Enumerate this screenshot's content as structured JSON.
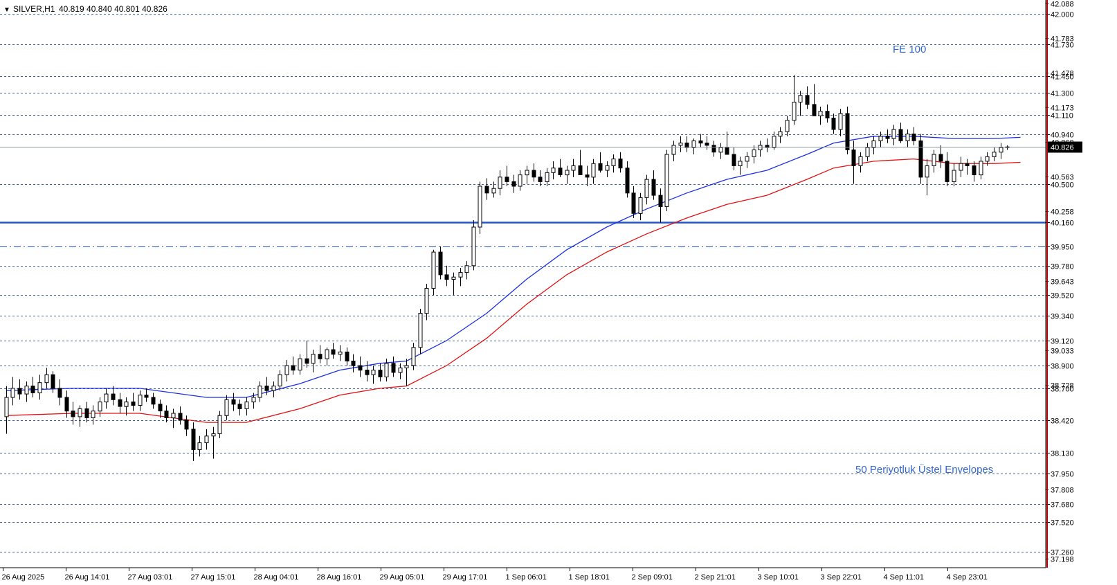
{
  "header": {
    "symbol": "SILVER,H1",
    "ohlc": "40.819 40.840 40.801 40.826"
  },
  "annotations": {
    "fe": "FE 100",
    "envelopes": "50 Periyotluk Üstel Envelopes"
  },
  "colors": {
    "background": "#ffffff",
    "grid_line": "#3a5fa0",
    "support_line": "#2255cc",
    "upper_envelope": "#1a2fe0",
    "lower_envelope": "#e01010",
    "candle": "#000000",
    "label_text": "#3366cc",
    "axis_border": "#b00000"
  },
  "chart_data": {
    "type": "candlestick",
    "title": "SILVER,H1",
    "ylim": [
      37.12,
      42.12
    ],
    "current_price": 40.826,
    "price_scale_ticks": [
      "42.088",
      "41.783",
      "41.478",
      "41.173",
      "40.868",
      "40.563",
      "40.258",
      "39.643",
      "39.033",
      "38.728",
      "37.808",
      "37.198"
    ],
    "level_lines": [
      {
        "value": 42.0,
        "label": "42.000",
        "style": "dashed"
      },
      {
        "value": 41.73,
        "label": "41.730",
        "style": "dashed"
      },
      {
        "value": 41.45,
        "label": "41.450",
        "style": "dashed"
      },
      {
        "value": 41.3,
        "label": "41.300",
        "style": "dashed"
      },
      {
        "value": 41.11,
        "label": "41.110",
        "style": "dashed"
      },
      {
        "value": 40.94,
        "label": "40.940",
        "style": "dashed"
      },
      {
        "value": 40.5,
        "label": "40.500",
        "style": "dashed"
      },
      {
        "value": 40.16,
        "label": "40.160",
        "style": "solid"
      },
      {
        "value": 39.95,
        "label": "39.950",
        "style": "dashdot"
      },
      {
        "value": 39.78,
        "label": "39.780",
        "style": "dashed"
      },
      {
        "value": 39.52,
        "label": "39.520",
        "style": "dashed"
      },
      {
        "value": 39.34,
        "label": "39.340",
        "style": "dashed"
      },
      {
        "value": 39.12,
        "label": "39.120",
        "style": "dashed"
      },
      {
        "value": 38.9,
        "label": "38.900",
        "style": "dashed"
      },
      {
        "value": 38.7,
        "label": "38.700",
        "style": "dashed"
      },
      {
        "value": 38.42,
        "label": "38.420",
        "style": "dashed"
      },
      {
        "value": 38.13,
        "label": "38.130",
        "style": "dashed"
      },
      {
        "value": 37.95,
        "label": "37.950",
        "style": "dashed"
      },
      {
        "value": 37.68,
        "label": "37.680",
        "style": "dashed"
      },
      {
        "value": 37.52,
        "label": "37.520",
        "style": "dashed"
      },
      {
        "value": 37.26,
        "label": "37.260",
        "style": "dashed"
      }
    ],
    "time_labels": [
      "26 Aug 2025",
      "26 Aug 14:01",
      "27 Aug 03:01",
      "27 Aug 15:01",
      "28 Aug 04:01",
      "28 Aug 16:01",
      "29 Aug 05:01",
      "29 Aug 17:01",
      "1 Sep 06:01",
      "1 Sep 18:01",
      "2 Sep 09:01",
      "2 Sep 21:01",
      "3 Sep 10:01",
      "3 Sep 22:01",
      "4 Sep 11:01",
      "4 Sep 23:01"
    ],
    "ohlc": [
      [
        38.45,
        38.72,
        38.3,
        38.62
      ],
      [
        38.62,
        38.8,
        38.55,
        38.7
      ],
      [
        38.7,
        38.78,
        38.6,
        38.65
      ],
      [
        38.65,
        38.76,
        38.58,
        38.72
      ],
      [
        38.72,
        38.8,
        38.62,
        38.66
      ],
      [
        38.66,
        38.82,
        38.6,
        38.75
      ],
      [
        38.75,
        38.88,
        38.7,
        38.82
      ],
      [
        38.82,
        38.85,
        38.66,
        38.7
      ],
      [
        38.7,
        38.78,
        38.55,
        38.62
      ],
      [
        38.62,
        38.68,
        38.44,
        38.5
      ],
      [
        38.5,
        38.58,
        38.38,
        38.45
      ],
      [
        38.45,
        38.55,
        38.36,
        38.52
      ],
      [
        38.52,
        38.58,
        38.4,
        38.44
      ],
      [
        38.44,
        38.55,
        38.38,
        38.5
      ],
      [
        38.5,
        38.62,
        38.45,
        38.58
      ],
      [
        38.58,
        38.7,
        38.52,
        38.65
      ],
      [
        38.65,
        38.72,
        38.55,
        38.6
      ],
      [
        38.6,
        38.66,
        38.48,
        38.54
      ],
      [
        38.54,
        38.62,
        38.46,
        38.58
      ],
      [
        38.58,
        38.66,
        38.5,
        38.55
      ],
      [
        38.55,
        38.68,
        38.5,
        38.64
      ],
      [
        38.64,
        38.7,
        38.58,
        38.62
      ],
      [
        38.62,
        38.66,
        38.52,
        38.56
      ],
      [
        38.56,
        38.6,
        38.44,
        38.5
      ],
      [
        38.5,
        38.55,
        38.4,
        38.44
      ],
      [
        38.44,
        38.52,
        38.35,
        38.48
      ],
      [
        38.48,
        38.54,
        38.38,
        38.42
      ],
      [
        38.42,
        38.46,
        38.28,
        38.34
      ],
      [
        38.34,
        38.4,
        38.06,
        38.16
      ],
      [
        38.16,
        38.28,
        38.1,
        38.22
      ],
      [
        38.22,
        38.34,
        38.16,
        38.28
      ],
      [
        38.28,
        38.36,
        38.08,
        38.3
      ],
      [
        38.3,
        38.5,
        38.26,
        38.46
      ],
      [
        38.46,
        38.64,
        38.42,
        38.6
      ],
      [
        38.6,
        38.66,
        38.5,
        38.56
      ],
      [
        38.56,
        38.6,
        38.46,
        38.52
      ],
      [
        38.52,
        38.62,
        38.46,
        38.58
      ],
      [
        38.58,
        38.66,
        38.52,
        38.62
      ],
      [
        38.62,
        38.76,
        38.58,
        38.72
      ],
      [
        38.72,
        38.8,
        38.64,
        38.68
      ],
      [
        38.68,
        38.76,
        38.62,
        38.72
      ],
      [
        38.72,
        38.86,
        38.68,
        38.82
      ],
      [
        38.82,
        38.95,
        38.76,
        38.9
      ],
      [
        38.9,
        38.98,
        38.82,
        38.86
      ],
      [
        38.86,
        39.0,
        38.82,
        38.96
      ],
      [
        38.96,
        39.12,
        38.88,
        38.92
      ],
      [
        38.92,
        39.04,
        38.84,
        39.0
      ],
      [
        39.0,
        39.08,
        38.92,
        38.96
      ],
      [
        38.96,
        39.06,
        38.9,
        39.04
      ],
      [
        39.04,
        39.1,
        38.96,
        39.0
      ],
      [
        39.0,
        39.08,
        38.94,
        39.02
      ],
      [
        39.02,
        39.06,
        38.9,
        38.94
      ],
      [
        38.94,
        39.0,
        38.84,
        38.9
      ],
      [
        38.9,
        38.98,
        38.8,
        38.86
      ],
      [
        38.86,
        38.94,
        38.76,
        38.82
      ],
      [
        38.82,
        38.9,
        38.74,
        38.86
      ],
      [
        38.86,
        38.92,
        38.76,
        38.8
      ],
      [
        38.8,
        38.96,
        38.76,
        38.92
      ],
      [
        38.92,
        38.98,
        38.8,
        38.84
      ],
      [
        38.84,
        38.92,
        38.78,
        38.88
      ],
      [
        38.88,
        38.96,
        38.72,
        38.9
      ],
      [
        38.9,
        39.1,
        38.86,
        39.06
      ],
      [
        39.06,
        39.4,
        39.0,
        39.36
      ],
      [
        39.36,
        39.62,
        39.3,
        39.58
      ],
      [
        39.58,
        39.92,
        39.52,
        39.9
      ],
      [
        39.9,
        39.95,
        39.66,
        39.7
      ],
      [
        39.7,
        39.78,
        39.6,
        39.66
      ],
      [
        39.66,
        39.72,
        39.52,
        39.68
      ],
      [
        39.68,
        39.76,
        39.6,
        39.72
      ],
      [
        39.72,
        39.82,
        39.66,
        39.78
      ],
      [
        39.78,
        40.18,
        39.74,
        40.12
      ],
      [
        40.12,
        40.52,
        40.06,
        40.48
      ],
      [
        40.48,
        40.55,
        40.36,
        40.42
      ],
      [
        40.42,
        40.52,
        40.38,
        40.46
      ],
      [
        40.46,
        40.62,
        40.4,
        40.56
      ],
      [
        40.56,
        40.66,
        40.48,
        40.52
      ],
      [
        40.52,
        40.58,
        40.42,
        40.48
      ],
      [
        40.48,
        40.62,
        40.44,
        40.58
      ],
      [
        40.58,
        40.66,
        40.5,
        40.62
      ],
      [
        40.62,
        40.68,
        40.52,
        40.56
      ],
      [
        40.56,
        40.62,
        40.48,
        40.52
      ],
      [
        40.52,
        40.64,
        40.48,
        40.6
      ],
      [
        40.6,
        40.7,
        40.54,
        40.64
      ],
      [
        40.64,
        40.72,
        40.56,
        40.58
      ],
      [
        40.58,
        40.66,
        40.5,
        40.62
      ],
      [
        40.62,
        40.72,
        40.56,
        40.66
      ],
      [
        40.66,
        40.8,
        40.62,
        40.58
      ],
      [
        40.58,
        40.66,
        40.48,
        40.56
      ],
      [
        40.56,
        40.72,
        40.5,
        40.68
      ],
      [
        40.68,
        40.78,
        40.6,
        40.62
      ],
      [
        40.62,
        40.7,
        40.56,
        40.66
      ],
      [
        40.66,
        40.76,
        40.6,
        40.72
      ],
      [
        40.72,
        40.78,
        40.6,
        40.64
      ],
      [
        40.64,
        40.7,
        40.38,
        40.42
      ],
      [
        40.42,
        40.48,
        40.2,
        40.24
      ],
      [
        40.24,
        40.42,
        40.18,
        40.38
      ],
      [
        40.38,
        40.58,
        40.32,
        40.54
      ],
      [
        40.54,
        40.62,
        40.36,
        40.4
      ],
      [
        40.4,
        40.46,
        40.16,
        40.3
      ],
      [
        40.3,
        40.8,
        40.26,
        40.76
      ],
      [
        40.76,
        40.88,
        40.7,
        40.84
      ],
      [
        40.84,
        40.92,
        40.78,
        40.86
      ],
      [
        40.86,
        40.92,
        40.78,
        40.82
      ],
      [
        40.82,
        40.9,
        40.76,
        40.88
      ],
      [
        40.88,
        40.94,
        40.82,
        40.86
      ],
      [
        40.86,
        40.92,
        40.8,
        40.84
      ],
      [
        40.84,
        40.88,
        40.74,
        40.78
      ],
      [
        40.78,
        40.86,
        40.72,
        40.82
      ],
      [
        40.82,
        40.96,
        40.76,
        40.76
      ],
      [
        40.76,
        40.82,
        40.62,
        40.66
      ],
      [
        40.66,
        40.74,
        40.58,
        40.7
      ],
      [
        40.7,
        40.78,
        40.64,
        40.74
      ],
      [
        40.74,
        40.84,
        40.68,
        40.8
      ],
      [
        40.8,
        40.88,
        40.74,
        40.84
      ],
      [
        40.84,
        40.9,
        40.78,
        40.82
      ],
      [
        40.82,
        40.96,
        40.8,
        40.92
      ],
      [
        40.92,
        41.0,
        40.86,
        40.96
      ],
      [
        40.96,
        41.1,
        40.92,
        41.06
      ],
      [
        41.06,
        41.46,
        41.02,
        41.22
      ],
      [
        41.22,
        41.32,
        41.1,
        41.28
      ],
      [
        41.28,
        41.36,
        41.16,
        41.2
      ],
      [
        41.2,
        41.38,
        41.14,
        41.1
      ],
      [
        41.1,
        41.18,
        41.02,
        41.14
      ],
      [
        41.14,
        41.2,
        41.04,
        41.08
      ],
      [
        41.08,
        41.12,
        40.94,
        40.98
      ],
      [
        40.98,
        41.16,
        40.92,
        41.12
      ],
      [
        41.12,
        41.18,
        40.76,
        40.8
      ],
      [
        40.8,
        40.88,
        40.5,
        40.66
      ],
      [
        40.66,
        40.78,
        40.6,
        40.74
      ],
      [
        40.74,
        40.86,
        40.7,
        40.82
      ],
      [
        40.82,
        40.92,
        40.76,
        40.88
      ],
      [
        40.88,
        40.96,
        40.82,
        40.92
      ],
      [
        40.92,
        40.98,
        40.86,
        40.9
      ],
      [
        40.9,
        41.02,
        40.84,
        40.98
      ],
      [
        40.98,
        41.04,
        40.86,
        40.88
      ],
      [
        40.88,
        40.98,
        40.82,
        40.94
      ],
      [
        40.94,
        41.0,
        40.84,
        40.88
      ],
      [
        40.88,
        40.94,
        40.5,
        40.56
      ],
      [
        40.56,
        40.72,
        40.4,
        40.66
      ],
      [
        40.66,
        40.8,
        40.6,
        40.76
      ],
      [
        40.76,
        40.84,
        40.64,
        40.7
      ],
      [
        40.7,
        40.78,
        40.48,
        40.52
      ],
      [
        40.52,
        40.68,
        40.48,
        40.62
      ],
      [
        40.62,
        40.74,
        40.56,
        40.68
      ],
      [
        40.68,
        40.72,
        40.58,
        40.66
      ],
      [
        40.66,
        40.7,
        40.52,
        40.58
      ],
      [
        40.58,
        40.74,
        40.54,
        40.7
      ],
      [
        40.7,
        40.78,
        40.66,
        40.74
      ],
      [
        40.74,
        40.82,
        40.7,
        40.78
      ],
      [
        40.78,
        40.86,
        40.72,
        40.82
      ],
      [
        40.82,
        40.84,
        40.8,
        40.826
      ]
    ],
    "upper_envelope": [
      [
        0,
        38.68
      ],
      [
        10,
        38.7
      ],
      [
        20,
        38.7
      ],
      [
        30,
        38.62
      ],
      [
        36,
        38.62
      ],
      [
        44,
        38.74
      ],
      [
        50,
        38.86
      ],
      [
        56,
        38.92
      ],
      [
        60,
        38.94
      ],
      [
        66,
        39.12
      ],
      [
        72,
        39.36
      ],
      [
        78,
        39.66
      ],
      [
        84,
        39.92
      ],
      [
        90,
        40.12
      ],
      [
        96,
        40.28
      ],
      [
        102,
        40.42
      ],
      [
        108,
        40.54
      ],
      [
        114,
        40.62
      ],
      [
        120,
        40.76
      ],
      [
        124,
        40.86
      ],
      [
        130,
        40.92
      ],
      [
        136,
        40.92
      ],
      [
        142,
        40.9
      ],
      [
        148,
        40.9
      ],
      [
        152,
        40.91
      ]
    ],
    "lower_envelope": [
      [
        0,
        38.46
      ],
      [
        10,
        38.48
      ],
      [
        20,
        38.48
      ],
      [
        30,
        38.4
      ],
      [
        36,
        38.4
      ],
      [
        44,
        38.52
      ],
      [
        50,
        38.64
      ],
      [
        56,
        38.7
      ],
      [
        60,
        38.72
      ],
      [
        66,
        38.9
      ],
      [
        72,
        39.14
      ],
      [
        78,
        39.44
      ],
      [
        84,
        39.7
      ],
      [
        90,
        39.9
      ],
      [
        96,
        40.06
      ],
      [
        102,
        40.2
      ],
      [
        108,
        40.32
      ],
      [
        114,
        40.4
      ],
      [
        120,
        40.54
      ],
      [
        124,
        40.64
      ],
      [
        130,
        40.7
      ],
      [
        136,
        40.72
      ],
      [
        142,
        40.68
      ],
      [
        148,
        40.68
      ],
      [
        152,
        40.69
      ]
    ]
  }
}
